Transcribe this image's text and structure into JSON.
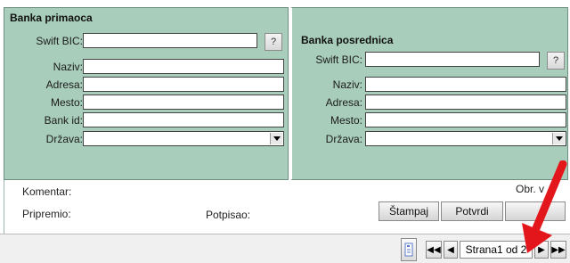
{
  "primalac": {
    "title": "Banka primaoca",
    "swift_label": "Swift BIC:",
    "swift_btn": "?",
    "naziv_label": "Naziv:",
    "adresa_label": "Adresa:",
    "mesto_label": "Mesto:",
    "bank_id_label": "Bank id:",
    "drzava_label": "Država:"
  },
  "posrednik": {
    "title": "Banka posrednica",
    "swift_label": "Swift BIC:",
    "swift_btn": "?",
    "naziv_label": "Naziv:",
    "adresa_label": "Adresa:",
    "mesto_label": "Mesto:",
    "drzava_label": "Država:"
  },
  "footer": {
    "komentar_label": "Komentar:",
    "obr_label": "Obr. v",
    "pripremio_label": "Pripremio:",
    "potpisao_label": "Potpisao:",
    "stampaj_label": "Štampaj",
    "potvrdi_label": "Potvrdi"
  },
  "navigation": {
    "page_label": "Strana1 od 2",
    "prev_label": "◀",
    "first_label": "◀◀",
    "next_label": "▶",
    "last_label": "▶▶"
  },
  "colors": {
    "panel_bg": "#a9cdbb",
    "annotation_arrow": "#e3161c"
  }
}
